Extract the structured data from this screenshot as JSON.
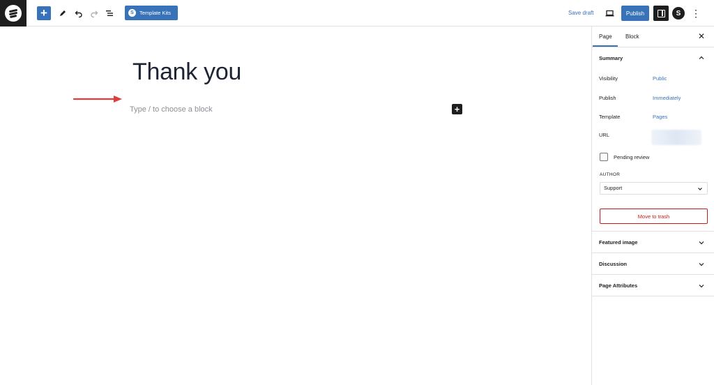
{
  "toolbar": {
    "template_kits_label": "Template Kits",
    "kit_badge": "S",
    "save_draft_label": "Save draft",
    "publish_label": "Publish",
    "plugin_badge": "S",
    "more_label": "⋮"
  },
  "editor": {
    "title": "Thank you",
    "block_placeholder": "Type / to choose a block",
    "annotation_color": "#e03e3e"
  },
  "sidebar": {
    "tabs": [
      {
        "label": "Page"
      },
      {
        "label": "Block"
      }
    ],
    "close_label": "✕",
    "summary": {
      "heading": "Summary",
      "rows": [
        {
          "label": "Visibility",
          "value": "Public"
        },
        {
          "label": "Publish",
          "value": "Immediately"
        },
        {
          "label": "Template",
          "value": "Pages"
        },
        {
          "label": "URL",
          "value": ""
        }
      ],
      "pending_review_label": "Pending review",
      "author_heading": "AUTHOR",
      "author_value": "Support",
      "trash_label": "Move to trash"
    },
    "panels": [
      {
        "label": "Featured image"
      },
      {
        "label": "Discussion"
      },
      {
        "label": "Page Attributes"
      }
    ]
  },
  "colors": {
    "accent": "#3873ba",
    "danger": "#cc1818",
    "dark": "#1e1e1e"
  }
}
